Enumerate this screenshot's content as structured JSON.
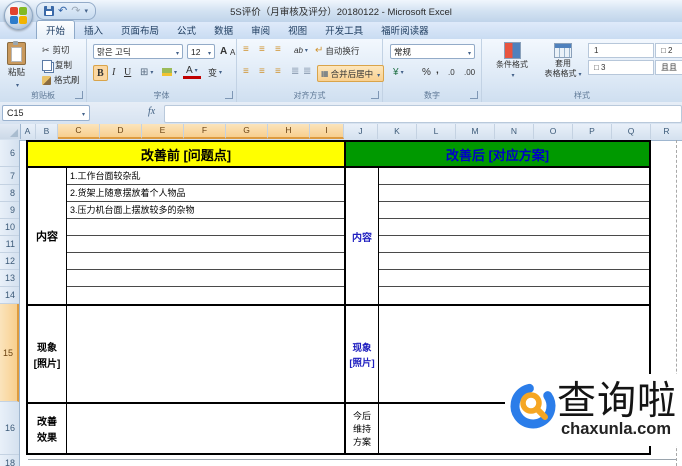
{
  "titlebar": {
    "title": "5S评价（月审核及评分）20180122 - Microsoft Excel",
    "qat": {
      "undo_icon": "↶",
      "redo_icon": "↷",
      "more_icon": "▾"
    }
  },
  "tabs": {
    "t0": "开始",
    "t1": "插入",
    "t2": "页面布局",
    "t3": "公式",
    "t4": "数据",
    "t5": "审阅",
    "t6": "视图",
    "t7": "开发工具",
    "t8": "福昕阅读器"
  },
  "ribbon": {
    "clipboard": {
      "group_label": "剪贴板",
      "paste": "粘贴",
      "cut": "剪切",
      "copy": "复制",
      "format_painter": "格式刷"
    },
    "font": {
      "group_label": "字体",
      "font_name": "맑은 고딕",
      "font_size": "12",
      "bold": "B",
      "italic": "I",
      "underline": "U",
      "grow": "A",
      "shrink": "A",
      "color": "A",
      "phonetic": "变"
    },
    "alignment": {
      "group_label": "对齐方式",
      "orientation": "ab",
      "wrap_text": "自动换行",
      "merge_center": "合并后居中"
    },
    "number": {
      "group_label": "数字",
      "format": "常规",
      "currency": "¥",
      "percent": "%",
      "comma": ",",
      "inc": ".0",
      "dec": ".00"
    },
    "styles": {
      "group_label": "样式",
      "conditional": "条件格式",
      "format_table_1": "套用",
      "format_table_2": "表格格式",
      "gallery": [
        "1",
        "□ 2",
        "□ 3",
        "且且"
      ]
    }
  },
  "formula_bar": {
    "cell_ref": "C15",
    "fx": "fx"
  },
  "col_headers": [
    "A",
    "B",
    "C",
    "D",
    "E",
    "F",
    "G",
    "H",
    "I",
    "J",
    "K",
    "L",
    "M",
    "N",
    "O",
    "P",
    "Q",
    "R"
  ],
  "row_headers": [
    "6",
    "7",
    "8",
    "9",
    "10",
    "11",
    "12",
    "13",
    "14",
    "15",
    "16",
    "18"
  ],
  "sheet": {
    "left": {
      "header": "改善前 [问题点]",
      "content_label": "内容",
      "items": [
        "1.工作台面较杂乱",
        "2.货架上随意摆放着个人物品",
        "3.压力机台面上摆放较多的杂物"
      ],
      "photo_label_line1": "现象",
      "photo_label_line2": "[照片]",
      "effect_label_line1": "改善",
      "effect_label_line2": "效果"
    },
    "right": {
      "header": "改善后 [对应方案]",
      "content_label": "内容",
      "photo_label_line1": "现象",
      "photo_label_line2": "[照片]",
      "plan_label_line1": "今后",
      "plan_label_line2": "维持",
      "plan_label_line3": "方案"
    }
  },
  "watermark": {
    "brand": "查询啦",
    "domain": "chaxunla.com"
  },
  "colors": {
    "before_header_bg": "#FFFF00",
    "after_header_bg": "#009900",
    "after_header_text": "#0000C8",
    "blue_label_text": "#2020C0",
    "selection_highlight": "#F8CF8E"
  }
}
